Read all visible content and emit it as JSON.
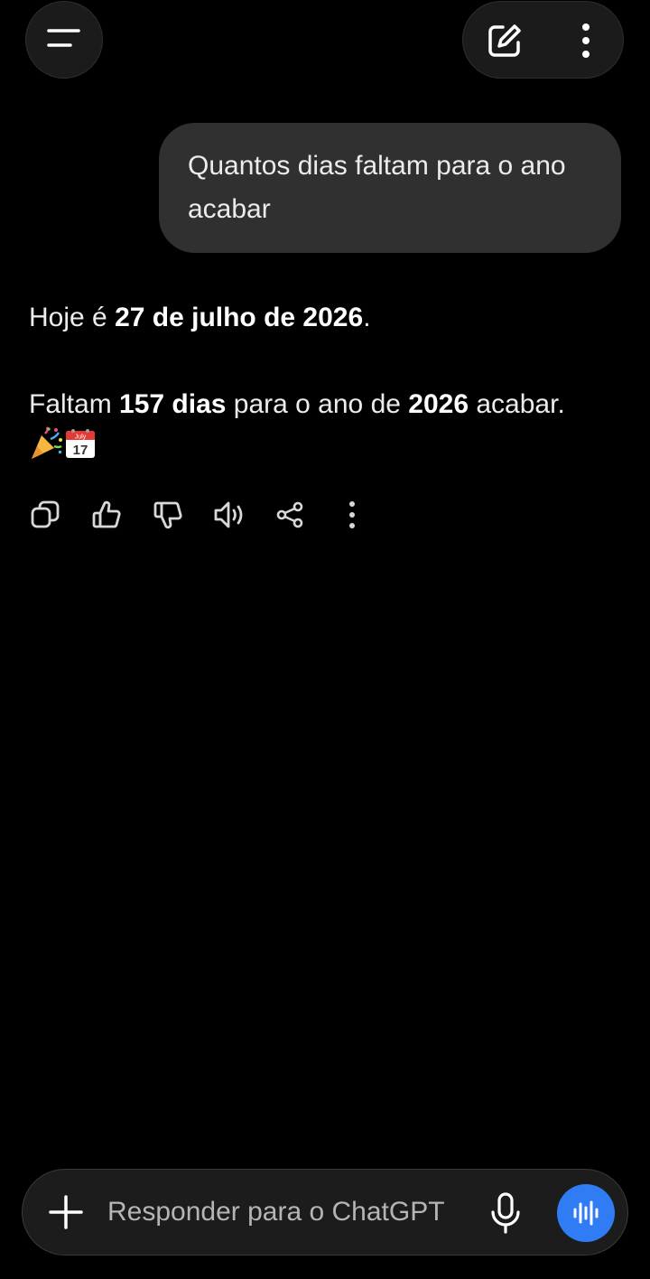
{
  "header": {
    "menu_icon": "menu-icon",
    "new_chat_icon": "edit-icon",
    "options_icon": "more-vertical-icon"
  },
  "conversation": {
    "user_message": "Quantos dias faltam para o ano acabar",
    "assistant": {
      "line1_prefix": "Hoje é ",
      "line1_bold": "27 de julho de 2026",
      "line1_suffix": ".",
      "line2_prefix": "Faltam ",
      "line2_bold_days": "157 dias",
      "line2_middle": " para o ano de ",
      "line2_bold_year": "2026",
      "line2_suffix": " acabar.",
      "emoji_calendar_month": "July",
      "emoji_calendar_day": "17"
    },
    "actions": [
      "copy-icon",
      "thumbs-up-icon",
      "thumbs-down-icon",
      "read-aloud-icon",
      "share-icon",
      "more-vertical-icon"
    ]
  },
  "composer": {
    "placeholder": "Responder para o ChatGPT",
    "voice_button_color": "#2f7cf5"
  },
  "colors": {
    "background": "#000000",
    "bubble": "#303030",
    "accent": "#2f7cf5"
  }
}
